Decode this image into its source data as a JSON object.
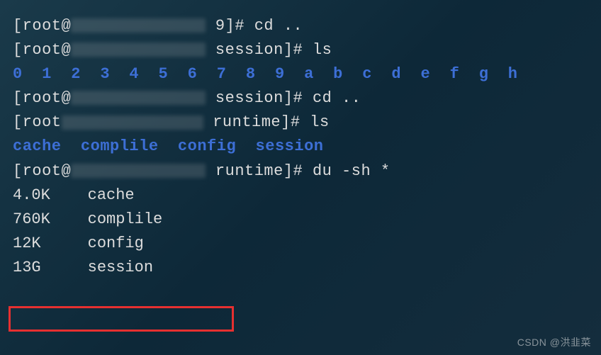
{
  "lines": {
    "l1_prefix": "[root@",
    "l1_dir": " 9]# ",
    "l1_cmd": "cd ..",
    "l2_prefix": "[root@",
    "l2_dir": " session]# ",
    "l2_cmd": "ls",
    "l3_items": "0  1  2  3  4  5  6  7  8  9  a  b  c  d  e  f  g  h",
    "l4_prefix": "[root@",
    "l4_dir": " session]# ",
    "l4_cmd": "cd ..",
    "l5_prefix": "[root",
    "l5_dir": " runtime]# ",
    "l5_cmd": "ls",
    "l6_items": "cache  complile  config  session",
    "l7_prefix": "[root@",
    "l7_dir": " runtime]# ",
    "l7_cmd": "du -sh *"
  },
  "du_output": [
    {
      "size": "4.0K",
      "name": "cache"
    },
    {
      "size": "760K",
      "name": "complile"
    },
    {
      "size": "12K",
      "name": "config"
    },
    {
      "size": "13G",
      "name": "session"
    }
  ],
  "watermark": "CSDN @洪韭菜"
}
